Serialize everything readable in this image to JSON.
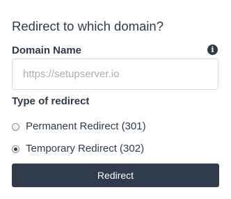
{
  "form": {
    "title": "Redirect to which domain?",
    "domain_label": "Domain Name",
    "info_icon": "info-icon",
    "domain_value": "",
    "domain_placeholder": "https://setupserver.io",
    "type_label": "Type of redirect",
    "options": [
      {
        "label": "Permanent Redirect (301)",
        "checked": false
      },
      {
        "label": "Temporary Redirect (302)",
        "checked": true
      }
    ],
    "submit_label": "Redirect"
  },
  "colors": {
    "text": "#2f3a46",
    "button_bg": "#2f3b4a",
    "button_text": "#ffffff",
    "input_border": "#d4d8dc",
    "placeholder": "#a9afb5"
  }
}
